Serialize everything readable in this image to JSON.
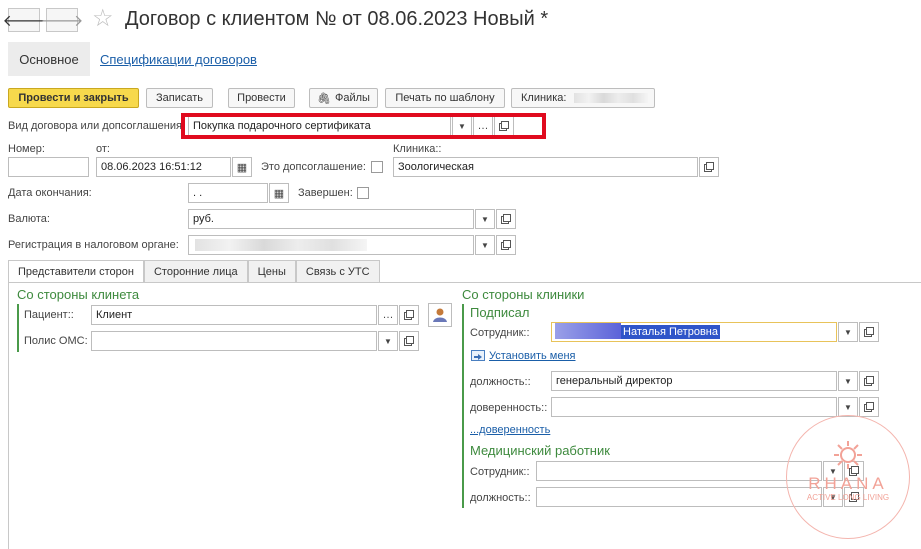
{
  "header": {
    "back_icon": "arrow-left-icon",
    "forward_icon": "arrow-right-icon",
    "favorite_icon": "star-icon",
    "title": "Договор с клиентом №  от 08.06.2023 Новый *"
  },
  "section_tabs": {
    "main": "Основное",
    "specs": "Спецификации договоров"
  },
  "toolbar": {
    "post_close": "Провести и закрыть",
    "save": "Записать",
    "post": "Провести",
    "files": "Файлы",
    "print_template": "Печать по шаблону",
    "clinic_label": "Клиника:"
  },
  "form": {
    "contract_type_label": "Вид договора или допсоглашения:",
    "contract_type_value": "Покупка подарочного сертификата",
    "number_label": "Номер:",
    "number_value": "",
    "from_label": "от:",
    "from_value": "08.06.2023 16:51:12",
    "addendum_label": "Это допсоглашение:",
    "clinic_label": "Клиника::",
    "clinic_value": "Зоологическая",
    "end_date_label": "Дата окончания:",
    "end_date_value": " .  .",
    "completed_label": "Завершен:",
    "currency_label": "Валюта:",
    "currency_value": "руб.",
    "tax_reg_label": "Регистрация в налоговом органе:"
  },
  "inner_tabs": [
    "Представители сторон",
    "Сторонние лица",
    "Цены",
    "Связь с УТС"
  ],
  "client_side": {
    "title": "Со стороны клинета",
    "patient_label": "Пациент::",
    "patient_value": "Клиент",
    "oms_label": "Полис ОМС:",
    "oms_value": ""
  },
  "clinic_side": {
    "title": "Со стороны клиники",
    "signed_title": "Подписал",
    "employee_label": "Сотрудник::",
    "employee_value": "Наталья Петровна",
    "set_me_link": "Установить меня",
    "position_label": "должность::",
    "position_value": "генеральный директор",
    "power_label": "доверенность::",
    "power_link": "...доверенность",
    "medical_title": "Медицинский работник",
    "med_employee_label": "Сотрудник::",
    "med_position_label": "должность::"
  },
  "watermark": {
    "brand": "RHANA",
    "tagline": "ACTIVE LONG LIVING"
  },
  "colors": {
    "primary_button": "#f7d94c",
    "highlight_border": "#e00a1e",
    "group_title": "#3e8a3e",
    "link": "#1a5ea8"
  }
}
